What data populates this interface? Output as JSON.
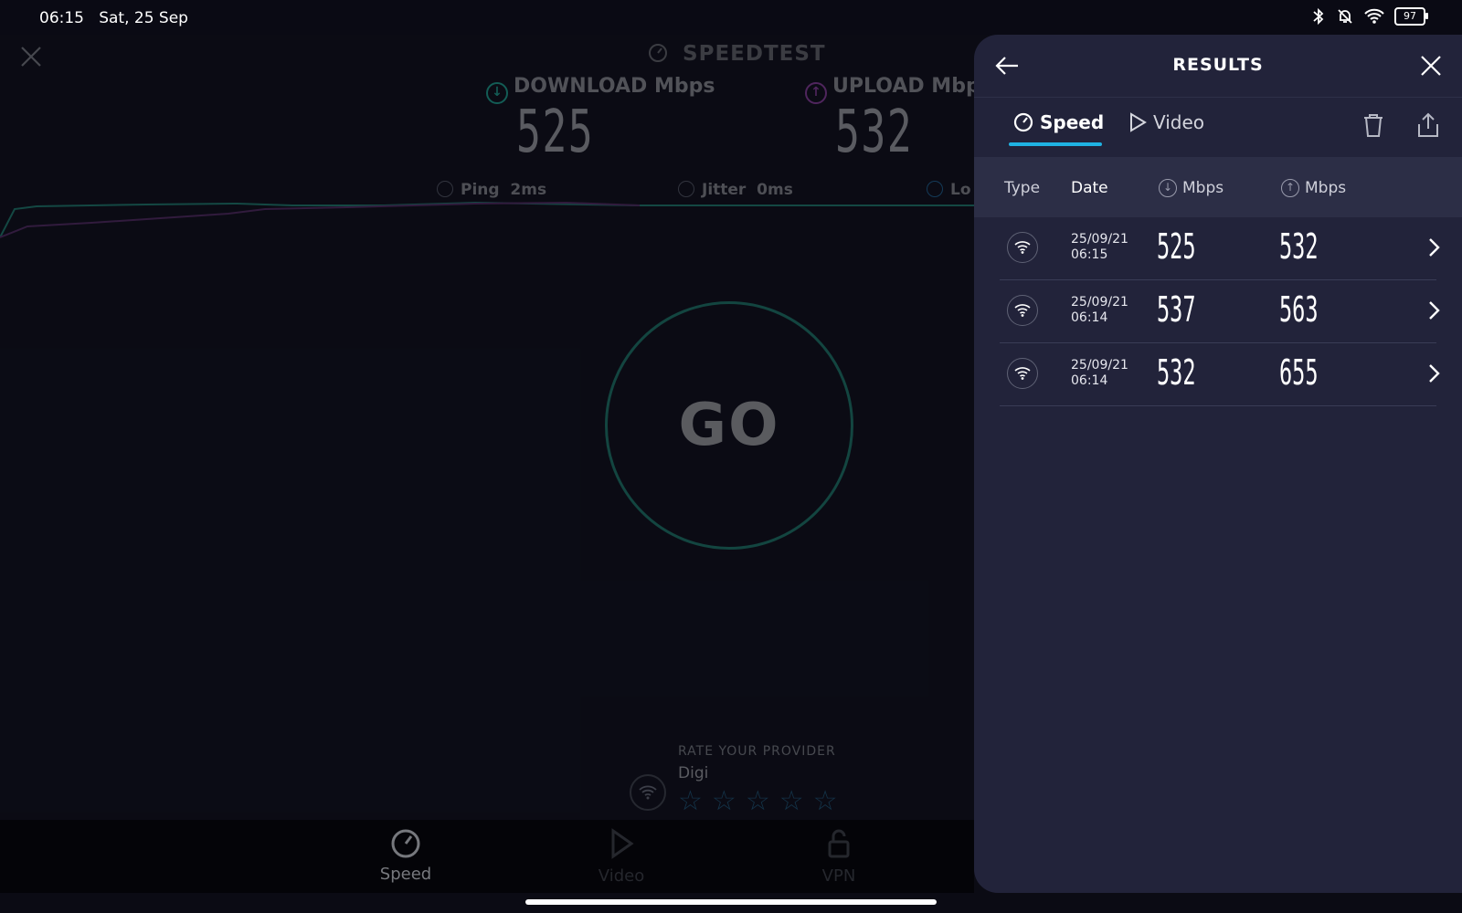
{
  "status_bar": {
    "time": "06:15",
    "date": "Sat, 25 Sep",
    "battery": "97"
  },
  "app": {
    "title": "SPEEDTEST",
    "download_label": "DOWNLOAD",
    "upload_label": "UPLOAD",
    "unit": "Mbps",
    "download_value": "525",
    "upload_value": "532",
    "ping_label": "Ping",
    "ping_value": "2ms",
    "jitter_label": "Jitter",
    "jitter_value": "0ms",
    "loss_label": "Lo",
    "go_label": "GO",
    "rate_title": "RATE YOUR PROVIDER",
    "provider": "Digi"
  },
  "bottom_nav": [
    {
      "label": "Speed",
      "icon": "speedometer-icon",
      "active": true
    },
    {
      "label": "Video",
      "icon": "play-icon",
      "active": false
    },
    {
      "label": "VPN",
      "icon": "lock-icon",
      "active": false
    }
  ],
  "results": {
    "title": "RESULTS",
    "tabs": [
      {
        "label": "Speed",
        "icon": "speedometer-icon",
        "active": true
      },
      {
        "label": "Video",
        "icon": "play-icon",
        "active": false
      }
    ],
    "columns": {
      "type": "Type",
      "date": "Date",
      "download": "Mbps",
      "upload": "Mbps"
    },
    "rows": [
      {
        "date": "25/09/21",
        "time": "06:15",
        "download": "525",
        "upload": "532"
      },
      {
        "date": "25/09/21",
        "time": "06:14",
        "download": "537",
        "upload": "563"
      },
      {
        "date": "25/09/21",
        "time": "06:14",
        "download": "532",
        "upload": "655"
      }
    ]
  },
  "colors": {
    "accent_tab": "#1fb2e3",
    "download": "#1e8e83",
    "upload": "#7a3a8f",
    "panel_bg": "#22233a"
  }
}
